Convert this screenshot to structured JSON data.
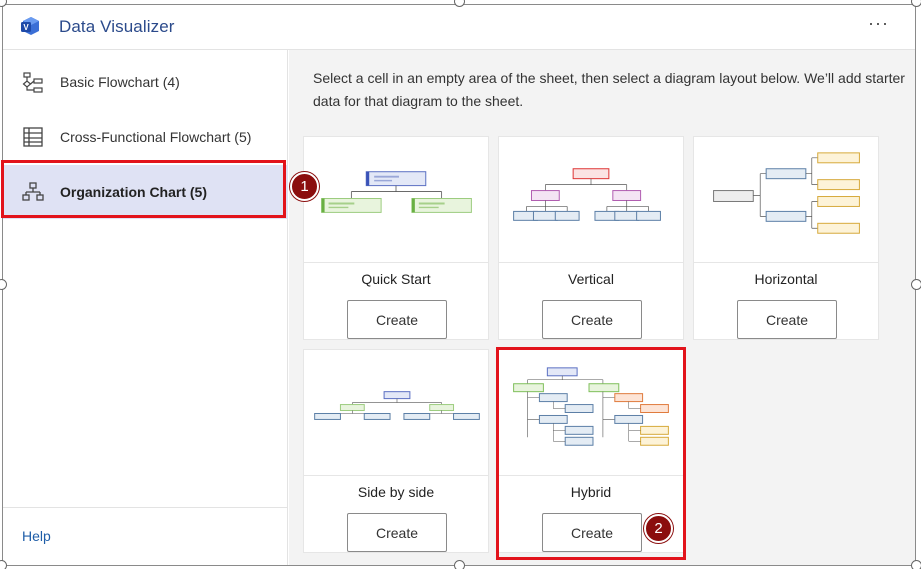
{
  "app": {
    "title": "Data Visualizer",
    "more_label": "···"
  },
  "sidebar": {
    "items": [
      {
        "label": "Basic Flowchart (4)",
        "icon": "flowchart-icon"
      },
      {
        "label": "Cross-Functional Flowchart (5)",
        "icon": "table-grid-icon"
      },
      {
        "label": "Organization Chart (5)",
        "icon": "org-chart-icon",
        "active": true
      }
    ],
    "help_label": "Help"
  },
  "main": {
    "instructions": "Select a cell in an empty area of the sheet, then select a diagram layout below. We’ll add starter data for that diagram to the sheet.",
    "cards": [
      {
        "title": "Quick Start",
        "button": "Create"
      },
      {
        "title": "Vertical",
        "button": "Create"
      },
      {
        "title": "Horizontal",
        "button": "Create"
      },
      {
        "title": "Side by side",
        "button": "Create"
      },
      {
        "title": "Hybrid",
        "button": "Create"
      }
    ]
  },
  "annotations": {
    "badge1": "1",
    "badge2": "2",
    "highlight_color": "#e2131b",
    "badge_color": "#8b0d0d"
  },
  "colors": {
    "accent": "#2b4a8b",
    "active_bg": "#dfe2f4",
    "panel_bg": "#f3f3f3"
  }
}
